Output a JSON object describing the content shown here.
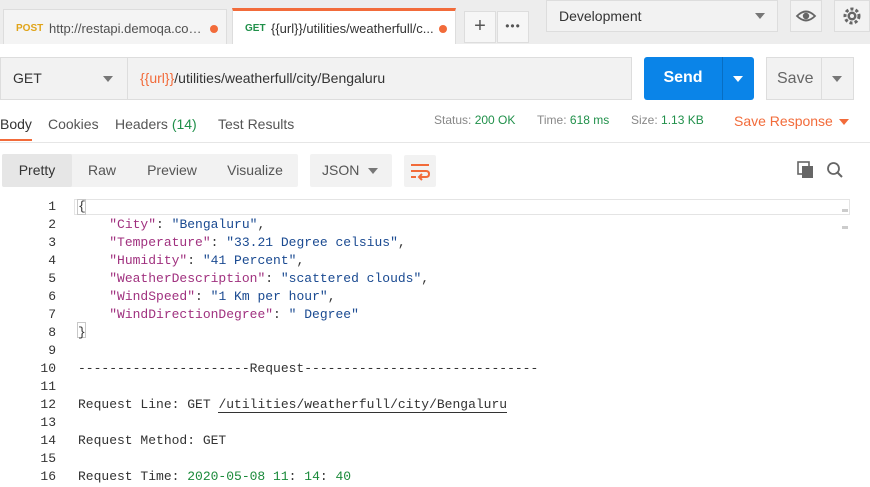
{
  "tabs": [
    {
      "method": "POST",
      "url": "http://restapi.demoqa.com..."
    },
    {
      "method": "GET",
      "url": "{{url}}/utilities/weatherfull/c..."
    }
  ],
  "tab_buttons": {
    "new_tab": "+",
    "more": "•••"
  },
  "environment": {
    "selected": "Development"
  },
  "request": {
    "method": "GET",
    "url_var": "{{url}}",
    "url_path": "/utilities/weatherfull/city/Bengaluru",
    "send_label": "Send",
    "save_label": "Save"
  },
  "response_tabs": {
    "body": "Body",
    "cookies": "Cookies",
    "headers": "Headers",
    "headers_count": "(14)",
    "test_results": "Test Results"
  },
  "status": {
    "status_label": "Status:",
    "status_value": "200 OK",
    "time_label": "Time:",
    "time_value": "618 ms",
    "size_label": "Size:",
    "size_value": "1.13 KB",
    "save_response": "Save Response"
  },
  "view_modes": {
    "pretty": "Pretty",
    "raw": "Raw",
    "preview": "Preview",
    "visualize": "Visualize"
  },
  "format": {
    "selected": "JSON"
  },
  "editor": {
    "line_numbers": [
      "1",
      "2",
      "3",
      "4",
      "5",
      "6",
      "7",
      "8",
      "9",
      "10",
      "11",
      "12",
      "13",
      "14",
      "15",
      "16"
    ],
    "l1": "{",
    "l2k": "\"City\"",
    "l2v": "\"Bengaluru\"",
    "l3k": "\"Temperature\"",
    "l3v": "\"33.21 Degree celsius\"",
    "l4k": "\"Humidity\"",
    "l4v": "\"41 Percent\"",
    "l5k": "\"WeatherDescription\"",
    "l5v": "\"scattered clouds\"",
    "l6k": "\"WindSpeed\"",
    "l6v": "\"1 Km per hour\"",
    "l7k": "\"WindDirectionDegree\"",
    "l7v": "\" Degree\"",
    "l8": "}",
    "l10": "----------------------Request------------------------------",
    "l12_label": "Request Line: GET ",
    "l12_path": "/utilities/weatherfull/city/Bengaluru",
    "l14": "Request Method: GET",
    "l16_label": "Request Time: ",
    "l16_date": "2020-05-08",
    "l16_h": "11",
    "l16_m": "14",
    "l16_s": "40"
  }
}
